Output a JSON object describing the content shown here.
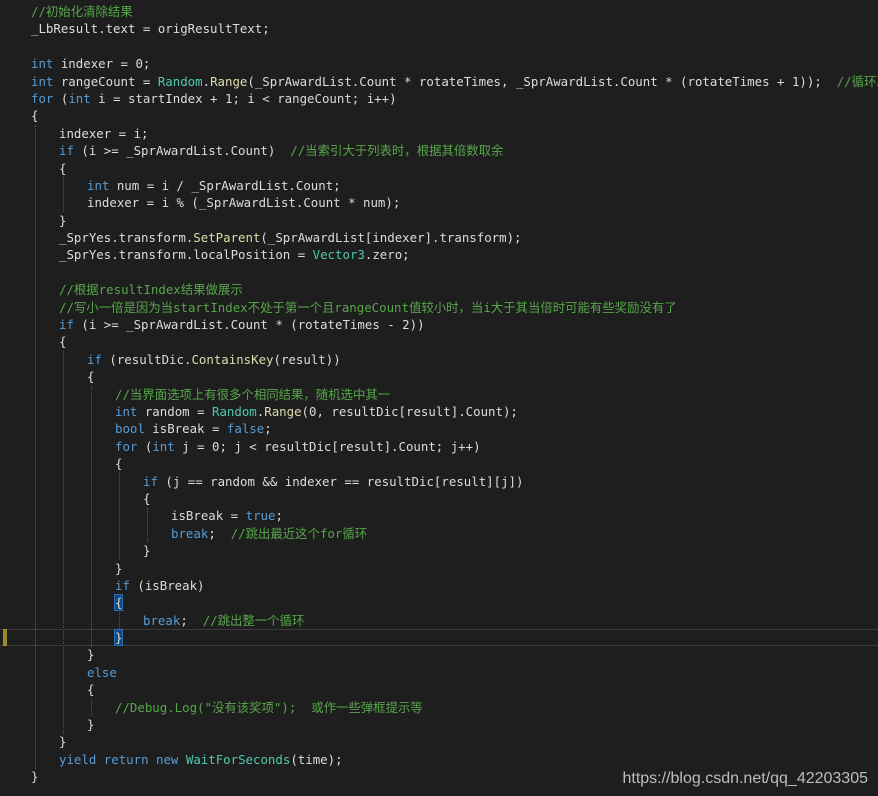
{
  "editor": {
    "theme_colors": {
      "background": "#1e1e1e",
      "keyword": "#569cd6",
      "type": "#4ec9b0",
      "method": "#dcdcaa",
      "comment": "#57a64a",
      "number": "#b5cea8",
      "text": "#dcdcdc"
    },
    "lines": [
      {
        "indent": 0,
        "tokens": [
          [
            "cm",
            "//初始化清除结果"
          ]
        ]
      },
      {
        "indent": 0,
        "tokens": [
          [
            "tx",
            "_LbResult.text = origResultText;"
          ]
        ]
      },
      {
        "indent": 0,
        "tokens": []
      },
      {
        "indent": 0,
        "tokens": [
          [
            "kw",
            "int"
          ],
          [
            "tx",
            " indexer = 0;"
          ]
        ]
      },
      {
        "indent": 0,
        "tokens": [
          [
            "kw",
            "int"
          ],
          [
            "tx",
            " rangeCount = "
          ],
          [
            "ty",
            "Random"
          ],
          [
            "tx",
            "."
          ],
          [
            "fn",
            "Range"
          ],
          [
            "tx",
            "(_SprAwardList.Count * rotateTimes, _SprAwardList.Count * (rotateTimes + 1));  "
          ],
          [
            "cm",
            "//循环次数"
          ]
        ]
      },
      {
        "indent": 0,
        "tokens": [
          [
            "kw",
            "for"
          ],
          [
            "tx",
            " ("
          ],
          [
            "kw",
            "int"
          ],
          [
            "tx",
            " i = startIndex + 1; i < rangeCount; i++)"
          ]
        ]
      },
      {
        "indent": 0,
        "tokens": [
          [
            "tx",
            "{"
          ]
        ]
      },
      {
        "indent": 1,
        "tokens": [
          [
            "tx",
            "indexer = i;"
          ]
        ]
      },
      {
        "indent": 1,
        "tokens": [
          [
            "kw",
            "if"
          ],
          [
            "tx",
            " (i >= _SprAwardList.Count)  "
          ],
          [
            "cm",
            "//当索引大于列表时，根据其倍数取余"
          ]
        ]
      },
      {
        "indent": 1,
        "tokens": [
          [
            "tx",
            "{"
          ]
        ]
      },
      {
        "indent": 2,
        "tokens": [
          [
            "kw",
            "int"
          ],
          [
            "tx",
            " num = i / _SprAwardList.Count;"
          ]
        ]
      },
      {
        "indent": 2,
        "tokens": [
          [
            "tx",
            "indexer = i % (_SprAwardList.Count * num);"
          ]
        ]
      },
      {
        "indent": 1,
        "tokens": [
          [
            "tx",
            "}"
          ]
        ]
      },
      {
        "indent": 1,
        "tokens": [
          [
            "tx",
            "_SprYes.transform."
          ],
          [
            "fn",
            "SetParent"
          ],
          [
            "tx",
            "(_SprAwardList[indexer].transform);"
          ]
        ]
      },
      {
        "indent": 1,
        "tokens": [
          [
            "tx",
            "_SprYes.transform.localPosition = "
          ],
          [
            "ty",
            "Vector3"
          ],
          [
            "tx",
            ".zero;"
          ]
        ]
      },
      {
        "indent": 1,
        "tokens": []
      },
      {
        "indent": 1,
        "tokens": [
          [
            "cm",
            "//根据resultIndex结果做展示"
          ]
        ]
      },
      {
        "indent": 1,
        "tokens": [
          [
            "cm",
            "//写小一倍是因为当startIndex不处于第一个且rangeCount值较小时，当i大于其当倍时可能有些奖励没有了"
          ]
        ]
      },
      {
        "indent": 1,
        "tokens": [
          [
            "kw",
            "if"
          ],
          [
            "tx",
            " (i >= _SprAwardList.Count * (rotateTimes - 2))"
          ]
        ]
      },
      {
        "indent": 1,
        "tokens": [
          [
            "tx",
            "{"
          ]
        ]
      },
      {
        "indent": 2,
        "tokens": [
          [
            "kw",
            "if"
          ],
          [
            "tx",
            " (resultDic."
          ],
          [
            "fn",
            "ContainsKey"
          ],
          [
            "tx",
            "(result))"
          ]
        ]
      },
      {
        "indent": 2,
        "tokens": [
          [
            "tx",
            "{"
          ]
        ]
      },
      {
        "indent": 3,
        "tokens": [
          [
            "cm",
            "//当界面选项上有很多个相同结果，随机选中其一"
          ]
        ]
      },
      {
        "indent": 3,
        "tokens": [
          [
            "kw",
            "int"
          ],
          [
            "tx",
            " random = "
          ],
          [
            "ty",
            "Random"
          ],
          [
            "tx",
            "."
          ],
          [
            "fn",
            "Range"
          ],
          [
            "tx",
            "(0, resultDic[result].Count);"
          ]
        ]
      },
      {
        "indent": 3,
        "tokens": [
          [
            "kw",
            "bool"
          ],
          [
            "tx",
            " isBreak = "
          ],
          [
            "kw",
            "false"
          ],
          [
            "tx",
            ";"
          ]
        ]
      },
      {
        "indent": 3,
        "tokens": [
          [
            "kw",
            "for"
          ],
          [
            "tx",
            " ("
          ],
          [
            "kw",
            "int"
          ],
          [
            "tx",
            " j = 0; j < resultDic[result].Count; j++)"
          ]
        ]
      },
      {
        "indent": 3,
        "tokens": [
          [
            "tx",
            "{"
          ]
        ]
      },
      {
        "indent": 4,
        "tokens": [
          [
            "kw",
            "if"
          ],
          [
            "tx",
            " (j == random && indexer == resultDic[result][j])"
          ]
        ]
      },
      {
        "indent": 4,
        "tokens": [
          [
            "tx",
            "{"
          ]
        ]
      },
      {
        "indent": 5,
        "tokens": [
          [
            "tx",
            "isBreak = "
          ],
          [
            "kw",
            "true"
          ],
          [
            "tx",
            ";"
          ]
        ]
      },
      {
        "indent": 5,
        "tokens": [
          [
            "kw",
            "break"
          ],
          [
            "tx",
            ";  "
          ],
          [
            "cm",
            "//跳出最近这个for循环"
          ]
        ]
      },
      {
        "indent": 4,
        "tokens": [
          [
            "tx",
            "}"
          ]
        ]
      },
      {
        "indent": 3,
        "tokens": [
          [
            "tx",
            "}"
          ]
        ]
      },
      {
        "indent": 3,
        "tokens": [
          [
            "kw",
            "if"
          ],
          [
            "tx",
            " (isBreak)"
          ]
        ]
      },
      {
        "indent": 3,
        "tokens": [
          [
            "hl",
            "{"
          ]
        ]
      },
      {
        "indent": 4,
        "tokens": [
          [
            "kw",
            "break"
          ],
          [
            "tx",
            ";  "
          ],
          [
            "cm",
            "//跳出整一个循环"
          ]
        ]
      },
      {
        "indent": 3,
        "current": true,
        "tokens": [
          [
            "hl",
            "}"
          ],
          [
            "cursor",
            ""
          ]
        ]
      },
      {
        "indent": 2,
        "tokens": [
          [
            "tx",
            "}"
          ]
        ]
      },
      {
        "indent": 2,
        "tokens": [
          [
            "kw",
            "else"
          ]
        ]
      },
      {
        "indent": 2,
        "tokens": [
          [
            "tx",
            "{"
          ]
        ]
      },
      {
        "indent": 3,
        "tokens": [
          [
            "cm",
            "//Debug.Log(\"没有该奖项\");  或作一些弹框提示等"
          ]
        ]
      },
      {
        "indent": 2,
        "tokens": [
          [
            "tx",
            "}"
          ]
        ]
      },
      {
        "indent": 1,
        "tokens": [
          [
            "tx",
            "}"
          ]
        ]
      },
      {
        "indent": 1,
        "tokens": [
          [
            "kw",
            "yield"
          ],
          [
            "tx",
            " "
          ],
          [
            "kw",
            "return"
          ],
          [
            "tx",
            " "
          ],
          [
            "kw",
            "new"
          ],
          [
            "tx",
            " "
          ],
          [
            "ty",
            "WaitForSeconds"
          ],
          [
            "tx",
            "(time);"
          ]
        ]
      },
      {
        "indent": 0,
        "tokens": [
          [
            "tx",
            "}"
          ]
        ]
      }
    ]
  },
  "watermark": "https://blog.csdn.net/qq_42203305"
}
